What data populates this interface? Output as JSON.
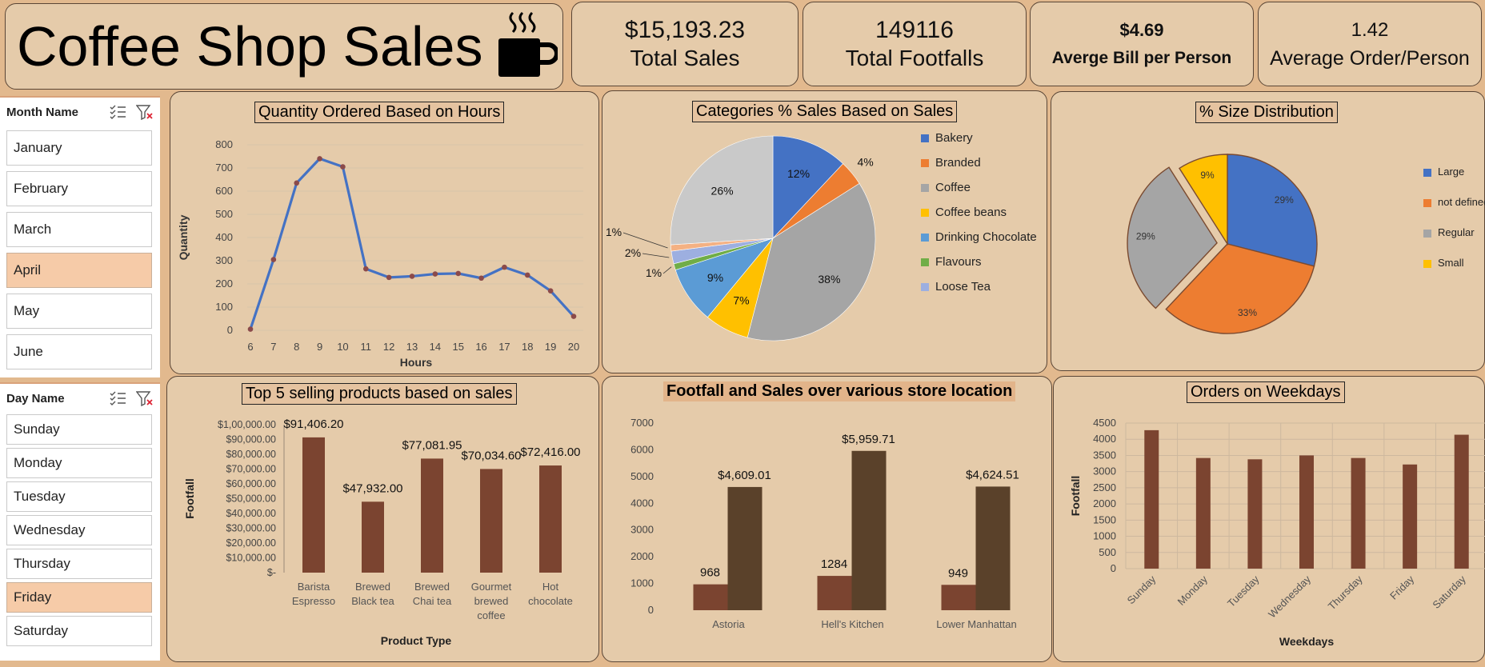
{
  "header": {
    "title": "Coffee Shop Sales",
    "icon": "coffee-cup-icon"
  },
  "kpis": [
    {
      "value": "$15,193.23",
      "label": "Total Sales"
    },
    {
      "value": "149116",
      "label": "Total Footfalls"
    },
    {
      "value": "$4.69",
      "label": "Averge Bill per Person"
    },
    {
      "value": "1.42",
      "label": "Average Order/Person"
    }
  ],
  "slicers": {
    "month": {
      "title": "Month Name",
      "items": [
        {
          "label": "January",
          "selected": false
        },
        {
          "label": "February",
          "selected": false
        },
        {
          "label": "March",
          "selected": false
        },
        {
          "label": "April",
          "selected": true
        },
        {
          "label": "May",
          "selected": false
        },
        {
          "label": "June",
          "selected": false
        }
      ]
    },
    "day": {
      "title": "Day Name",
      "items": [
        {
          "label": "Sunday",
          "selected": false
        },
        {
          "label": "Monday",
          "selected": false
        },
        {
          "label": "Tuesday",
          "selected": false
        },
        {
          "label": "Wednesday",
          "selected": false
        },
        {
          "label": "Thursday",
          "selected": false
        },
        {
          "label": "Friday",
          "selected": true
        },
        {
          "label": "Saturday",
          "selected": false
        }
      ]
    }
  },
  "colors": {
    "background": "#E2B98E",
    "card": "#E5CBAA",
    "line": "#4472C4",
    "bar_dark": "#7B4430",
    "bar_darker": "#5A412A",
    "selected": "#F6CBA8"
  },
  "chart_data": [
    {
      "id": "hours",
      "type": "line",
      "title": "Quantity Ordered Based on Hours",
      "xlabel": "Hours",
      "ylabel": "Quantity",
      "x": [
        6,
        7,
        8,
        9,
        10,
        11,
        12,
        13,
        14,
        15,
        16,
        17,
        18,
        19,
        20
      ],
      "values": [
        5,
        305,
        635,
        740,
        705,
        265,
        228,
        233,
        243,
        245,
        225,
        272,
        238,
        170,
        60
      ],
      "yticks": [
        0,
        100,
        200,
        300,
        400,
        500,
        600,
        700,
        800
      ],
      "ylim": [
        0,
        800
      ],
      "grid": true
    },
    {
      "id": "categories",
      "type": "pie",
      "title": "Categories % Sales Based on Sales",
      "legend": "right",
      "slices": [
        {
          "name": "Bakery",
          "value": 12,
          "label": "12%",
          "color": "#4472C4"
        },
        {
          "name": "Branded",
          "value": 4,
          "label": "4%",
          "color": "#ED7D31"
        },
        {
          "name": "Coffee",
          "value": 38,
          "label": "38%",
          "color": "#A5A5A5"
        },
        {
          "name": "Coffee beans",
          "value": 7,
          "label": "7%",
          "color": "#FFC000"
        },
        {
          "name": "Drinking Chocolate",
          "value": 9,
          "label": "9%",
          "color": "#5B9BD5"
        },
        {
          "name": "Flavours",
          "value": 1,
          "label": "1%",
          "color": "#70AD47"
        },
        {
          "name": "Loose Tea",
          "value": 2,
          "label": "2%",
          "color": "#9DAFE0"
        },
        {
          "name": "",
          "value": 1,
          "label": "1%",
          "color": "#F4B183"
        },
        {
          "name": "",
          "value": 26,
          "label": "26%",
          "color": "#C9C9C9"
        }
      ]
    },
    {
      "id": "size",
      "type": "pie",
      "title": "% Size Distribution",
      "legend": "right",
      "slices": [
        {
          "name": "Large",
          "value": 29,
          "label": "29%",
          "color": "#4472C4"
        },
        {
          "name": "not defined",
          "value": 33,
          "label": "33%",
          "color": "#ED7D31"
        },
        {
          "name": "Regular",
          "value": 29,
          "label": "29%",
          "color": "#A5A5A5"
        },
        {
          "name": "Small",
          "value": 9,
          "label": "9%",
          "color": "#FFC000"
        }
      ]
    },
    {
      "id": "products",
      "type": "bar",
      "title": "Top 5 selling products based on sales",
      "xlabel": "Product Type",
      "ylabel": "Footfall",
      "categories": [
        [
          "Barista",
          "Espresso"
        ],
        [
          "Brewed",
          "Black tea"
        ],
        [
          "Brewed",
          "Chai tea"
        ],
        [
          "Gourmet",
          "brewed",
          "coffee"
        ],
        [
          "Hot",
          "chocolate"
        ]
      ],
      "values": [
        91406.2,
        47932.0,
        77081.95,
        70034.6,
        72416.0
      ],
      "data_labels": [
        "$91,406.20",
        "$47,932.00",
        "$77,081.95",
        "$70,034.60",
        "$72,416.00"
      ],
      "yticks": [
        "$-",
        "$10,000.00",
        "$20,000.00",
        "$30,000.00",
        "$40,000.00",
        "$50,000.00",
        "$60,000.00",
        "$70,000.00",
        "$80,000.00",
        "$90,000.00",
        "$1,00,000.00"
      ],
      "ylim": [
        0,
        100000
      ]
    },
    {
      "id": "locations",
      "type": "bar",
      "title": "Footfall and Sales over various store location",
      "categories": [
        "Astoria",
        "Hell's Kitchen",
        "Lower Manhattan"
      ],
      "series": [
        {
          "values": [
            968,
            1284,
            949
          ],
          "labels": [
            "968",
            "1284",
            "949"
          ],
          "color": "#7B4430"
        },
        {
          "values": [
            4609.01,
            5959.71,
            4624.51
          ],
          "labels": [
            "$4,609.01",
            "$5,959.71",
            "$4,624.51"
          ],
          "color": "#5A412A"
        }
      ],
      "yticks": [
        0,
        1000,
        2000,
        3000,
        4000,
        5000,
        6000,
        7000
      ],
      "ylim": [
        0,
        7000
      ]
    },
    {
      "id": "weekdays",
      "type": "bar",
      "title": "Orders on Weekdays",
      "xlabel": "Weekdays",
      "ylabel": "Footfall",
      "categories": [
        "Sunday",
        "Monday",
        "Tuesday",
        "Wednesday",
        "Thursday",
        "Friday",
        "Saturday"
      ],
      "values": [
        4280,
        3420,
        3380,
        3500,
        3420,
        3220,
        4140
      ],
      "yticks": [
        0,
        500,
        1000,
        1500,
        2000,
        2500,
        3000,
        3500,
        4000,
        4500
      ],
      "ylim": [
        0,
        4500
      ],
      "grid": true
    }
  ]
}
